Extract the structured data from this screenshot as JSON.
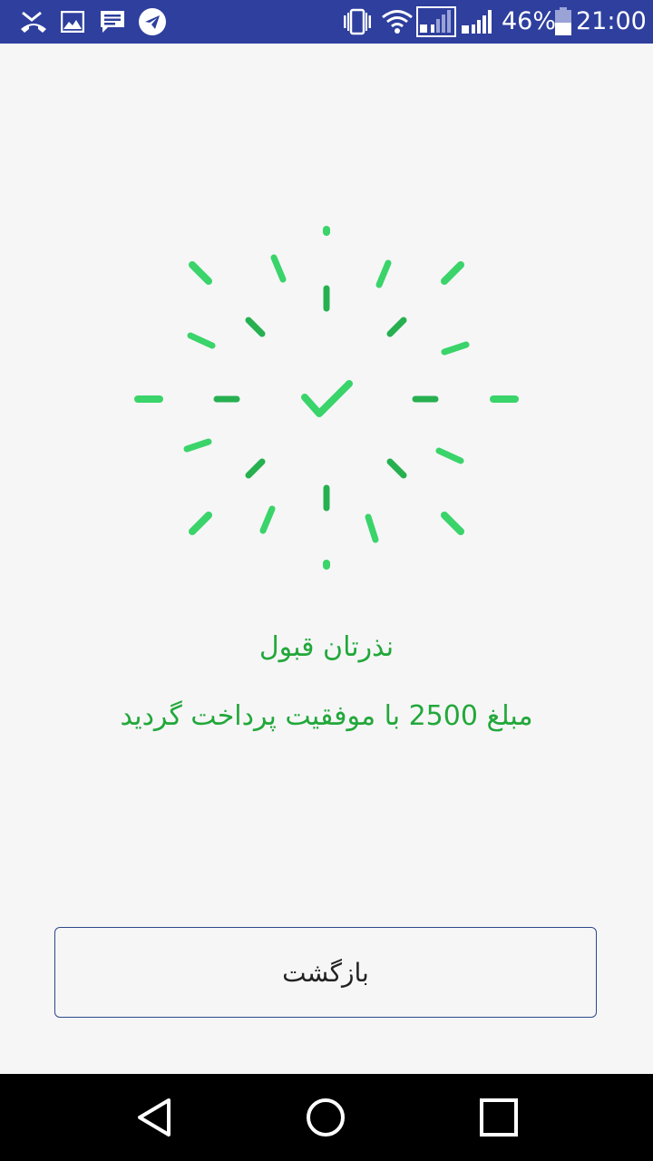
{
  "status_bar": {
    "battery_percent": "46%",
    "time": "21:00",
    "icons": [
      "missed-call-icon",
      "image-icon",
      "message-icon",
      "telegram-icon",
      "vibrate-icon",
      "wifi-icon",
      "signal-sim1-icon",
      "signal-sim2-icon",
      "battery-icon"
    ]
  },
  "success": {
    "icon": "checkmark-icon",
    "accent_color": "#2ecc5e",
    "title": "نذرتان قبول",
    "message": "مبلغ 2500 با موفقیت پرداخت گردید"
  },
  "actions": {
    "back_label": "بازگشت"
  },
  "nav_bar": {
    "icons": [
      "back-triangle-icon",
      "home-circle-icon",
      "recents-square-icon"
    ]
  }
}
